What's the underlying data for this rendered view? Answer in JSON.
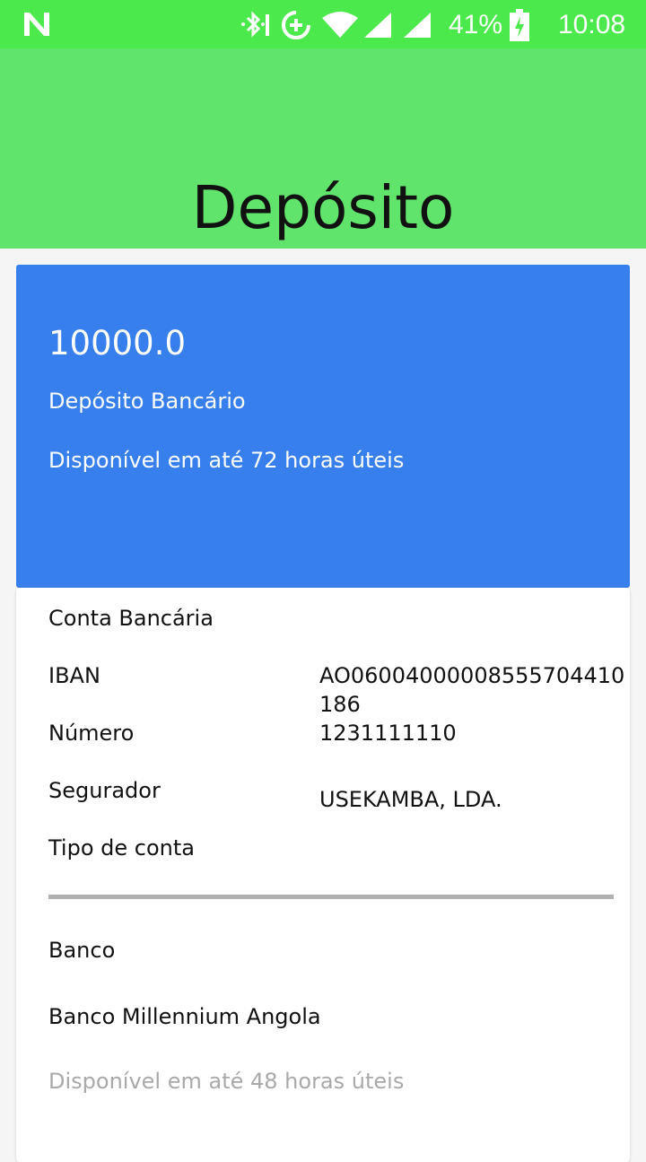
{
  "status_bar": {
    "battery_percent": "41%",
    "time": "10:08",
    "icons": [
      "n-icon",
      "bluetooth-icon",
      "data-saver-icon",
      "wifi-icon",
      "signal-icon",
      "signal-icon",
      "battery-charging-icon"
    ],
    "background_color": "#4ce94c"
  },
  "header": {
    "title": "Depósito",
    "background_color": "#61e46b"
  },
  "summary": {
    "amount": "10000.0",
    "method": "Depósito Bancário",
    "availability": "Disponível em até 72 horas úteis",
    "background_color": "#377fec"
  },
  "bank_account": {
    "section_title": "Conta Bancária",
    "iban_label": "IBAN",
    "iban_value": "AO06004000008555704410186",
    "numero_label": "Número",
    "numero_value": "1231111110",
    "segurador_label": "Segurador",
    "segurador_value": "USEKAMBA, LDA.",
    "tipo_label": "Tipo de conta",
    "tipo_value": ""
  },
  "bank": {
    "label": "Banco",
    "name": "Banco Millennium Angola",
    "availability": "Disponível em até 48 horas úteis"
  }
}
